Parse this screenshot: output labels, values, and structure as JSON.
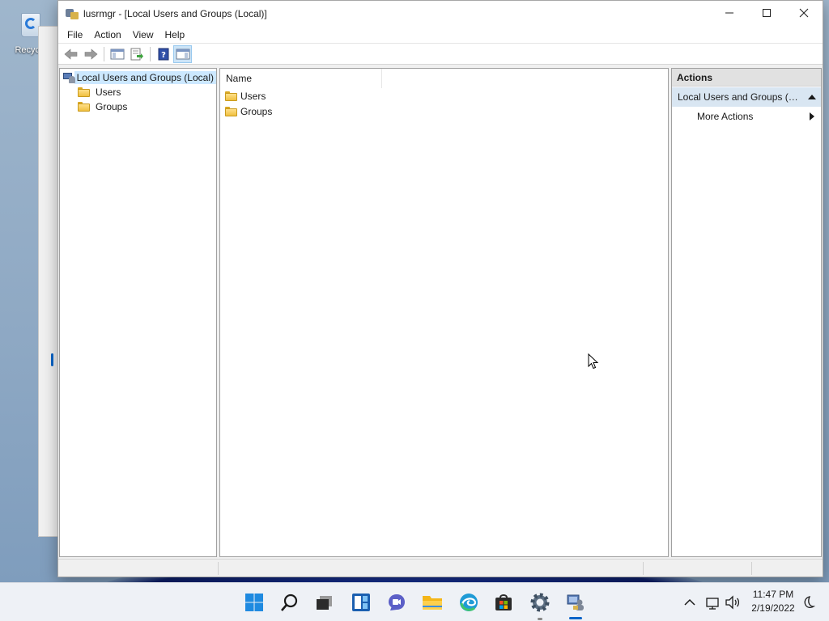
{
  "desktop": {
    "recycle_bin_label": "Recycle"
  },
  "window": {
    "title": "lusrmgr - [Local Users and Groups (Local)]",
    "controls": {
      "minimize": "minimize",
      "maximize": "maximize",
      "close": "close"
    }
  },
  "menu": {
    "items": [
      "File",
      "Action",
      "View",
      "Help"
    ]
  },
  "toolbar": {
    "buttons": [
      "back-arrow-icon",
      "forward-arrow-icon",
      "show-hide-console-tree-icon",
      "export-list-icon",
      "help-icon",
      "show-hide-action-pane-icon"
    ]
  },
  "tree": {
    "root_label": "Local Users and Groups (Local)",
    "children": [
      "Users",
      "Groups"
    ]
  },
  "list": {
    "columns": [
      "Name"
    ],
    "rows": [
      "Users",
      "Groups"
    ]
  },
  "actions": {
    "header": "Actions",
    "section_label": "Local Users and Groups (Lo...",
    "more_actions_label": "More Actions"
  },
  "taskbar": {
    "icons": [
      "start-icon",
      "search-icon",
      "task-view-icon",
      "widgets-icon",
      "chat-icon",
      "file-explorer-icon",
      "edge-icon",
      "store-icon",
      "settings-icon",
      "lusrmgr-icon"
    ],
    "clock_time": "11:47 PM",
    "clock_date": "2/19/2022"
  },
  "colors": {
    "accent": "#0a64c8",
    "selection": "#cce8ff",
    "actions_section_bg": "#d9e6f2"
  }
}
